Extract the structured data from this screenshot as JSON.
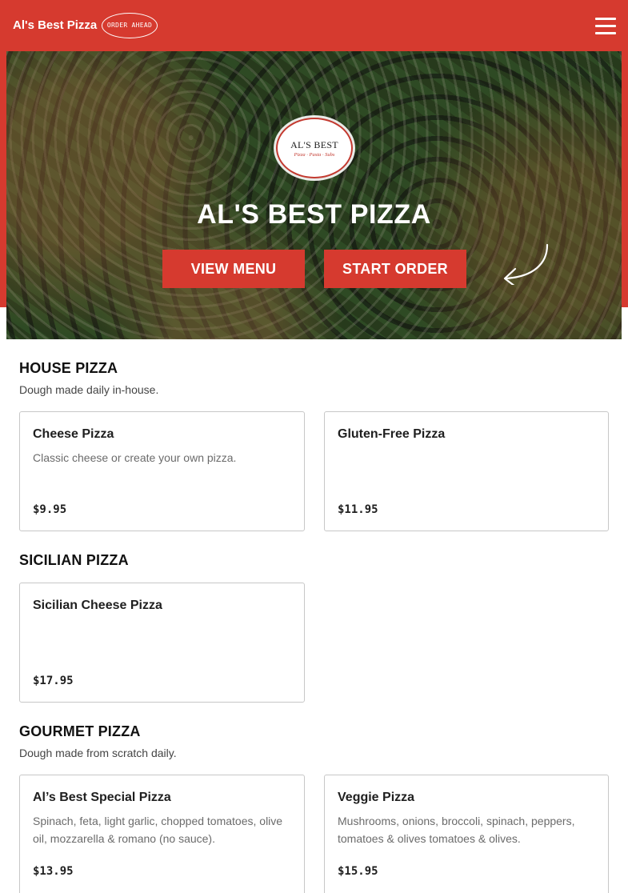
{
  "header": {
    "brand": "Al's Best Pizza",
    "order_badge": "Order Ahead",
    "menu_icon": "hamburger-menu-icon",
    "background_color": "#d63a2f"
  },
  "hero": {
    "logo_name": "AL'S BEST",
    "logo_tagline": "Pizza · Pasta · Subs",
    "title": "AL'S BEST PIZZA",
    "view_menu_label": "VIEW MENU",
    "start_order_label": "START ORDER",
    "arrow_icon": "curved-arrow-icon",
    "button_color": "#d63a2f"
  },
  "sections": [
    {
      "title": "HOUSE PIZZA",
      "description": "Dough made daily in-house.",
      "items": [
        {
          "name": "Cheese Pizza",
          "description": "Classic cheese or create your own pizza.",
          "price": "$9.95"
        },
        {
          "name": "Gluten-Free Pizza",
          "description": "",
          "price": "$11.95"
        }
      ]
    },
    {
      "title": "SICILIAN PIZZA",
      "description": "",
      "items": [
        {
          "name": "Sicilian Cheese Pizza",
          "description": "",
          "price": "$17.95"
        }
      ]
    },
    {
      "title": "GOURMET PIZZA",
      "description": "Dough made from scratch daily.",
      "items": [
        {
          "name": "Al’s Best Special Pizza",
          "description": "Spinach, feta, light garlic, chopped tomatoes, olive oil, mozzarella & romano (no sauce).",
          "price": "$13.95"
        },
        {
          "name": "Veggie Pizza",
          "description": "Mushrooms, onions, broccoli, spinach, peppers, tomatoes & olives tomatoes & olives.",
          "price": "$15.95"
        }
      ]
    }
  ]
}
